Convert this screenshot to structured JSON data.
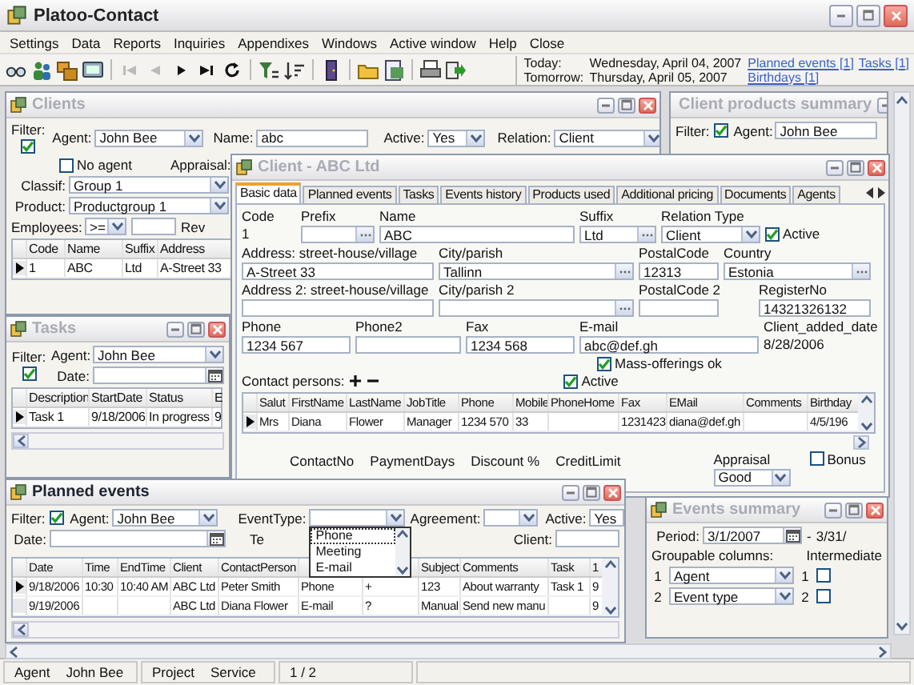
{
  "window": {
    "title": "Platoo-Contact"
  },
  "menu": [
    "Settings",
    "Data",
    "Reports",
    "Inquiries",
    "Appendixes",
    "Windows",
    "Active window",
    "Help",
    "Close"
  ],
  "agenda": {
    "today_label": "Today:",
    "today": "Wednesday, April 04, 2007",
    "tomorrow_label": "Tomorrow:",
    "tomorrow": "Thursday, April 05, 2007",
    "links": [
      "Planned events [1]",
      "Tasks [1]",
      "Birthdays [1]"
    ]
  },
  "clients": {
    "title": "Clients",
    "active": false,
    "filter": {
      "label": "Filter:",
      "checked": true
    },
    "agent": {
      "label": "Agent:",
      "value": "John Bee",
      "kind": "combo"
    },
    "name": {
      "label": "Name:",
      "value": "abc",
      "kind": "text"
    },
    "active_field": {
      "label": "Active:",
      "value": "Yes",
      "kind": "combo"
    },
    "relation": {
      "label": "Relation:",
      "value": "Client",
      "kind": "combo"
    },
    "no_agent": {
      "label": "No agent",
      "checked": false
    },
    "appraisal_label": "Appraisal:",
    "classif": {
      "label": "Classif:",
      "value": "Group 1",
      "kind": "combo"
    },
    "product": {
      "label": "Product:",
      "value": "Productgroup 1",
      "kind": "combo"
    },
    "employees": {
      "label": "Employees:",
      "value": ">=",
      "kind": "combo"
    },
    "employees_value": {
      "kind": "text"
    },
    "rev_label": "Rev",
    "table": {
      "columns": [
        "Code",
        "Name",
        "Suffix",
        "Address"
      ],
      "rows": [
        {
          "selected": true,
          "cells": [
            "1",
            "ABC",
            "Ltd",
            "A-Street 33"
          ]
        }
      ]
    }
  },
  "products_summary": {
    "title": "Client products summary",
    "active": false,
    "filter": {
      "label": "Filter:",
      "checked": true
    },
    "agent": {
      "label": "Agent:",
      "value": "John Bee",
      "kind": "text"
    }
  },
  "tasks": {
    "title": "Tasks",
    "active": false,
    "filter": {
      "label": "Filter:",
      "checked": true
    },
    "agent": {
      "label": "Agent:",
      "value": "John Bee",
      "kind": "combo"
    },
    "date": {
      "label": "Date:",
      "kind": "date"
    },
    "table": {
      "columns": [
        "Description",
        "StartDate",
        "Status",
        "E"
      ],
      "rows": [
        {
          "selected": true,
          "cells": [
            "Task 1",
            "9/18/2006",
            "In progress",
            "9"
          ]
        }
      ]
    }
  },
  "client_card": {
    "title": "Client - ABC Ltd",
    "active": false,
    "tabs": [
      {
        "label": "Basic data",
        "selected": true
      },
      {
        "label": "Planned events",
        "selected": false
      },
      {
        "label": "Tasks",
        "selected": false
      },
      {
        "label": "Events history",
        "selected": false
      },
      {
        "label": "Products used",
        "selected": false
      },
      {
        "label": "Additional pricing",
        "selected": false
      },
      {
        "label": "Documents",
        "selected": false
      },
      {
        "label": "Agents",
        "selected": false
      }
    ],
    "fields": [
      [
        {
          "label": "Code",
          "value": "1",
          "kind": "plain"
        },
        {
          "label": "Prefix",
          "kind": "lookup"
        },
        {
          "label": "Name",
          "value": "ABC",
          "kind": "text"
        },
        {
          "label": "Suffix",
          "value": "Ltd",
          "kind": "lookup"
        },
        {
          "label": "Relation Type",
          "value": "Client",
          "kind": "combo"
        },
        {
          "label": "Active",
          "checked": true,
          "kind": "check"
        }
      ],
      [
        {
          "label": "Address: street-house/village",
          "value": "A-Street 33",
          "kind": "text"
        },
        {
          "label": "City/parish",
          "value": "Tallinn",
          "kind": "lookup"
        },
        {
          "label": "PostalCode",
          "value": "12313",
          "kind": "text"
        },
        {
          "label": "Country",
          "value": "Estonia",
          "kind": "lookup"
        }
      ],
      [
        {
          "label": "Address 2: street-house/village",
          "kind": "text"
        },
        {
          "label": "City/parish 2",
          "kind": "lookup"
        },
        {
          "label": "PostalCode 2",
          "kind": "text"
        },
        {
          "label": "RegisterNo",
          "value": "14321326132",
          "kind": "text"
        }
      ],
      [
        {
          "label": "Phone",
          "value": "1234 567",
          "kind": "text"
        },
        {
          "label": "Phone2",
          "kind": "text"
        },
        {
          "label": "Fax",
          "value": "1234 568",
          "kind": "text"
        },
        {
          "label": "E-mail",
          "value": "abc@def.gh",
          "kind": "text"
        },
        {
          "label": "Client_added_date",
          "value": "8/28/2006",
          "kind": "plain"
        }
      ]
    ],
    "mass_offerings": {
      "label": "Mass-offerings ok",
      "checked": true
    },
    "contacts": {
      "label": "Contact persons:",
      "active": {
        "label": "Active",
        "checked": true
      },
      "table": {
        "columns": [
          "Salut",
          "FirstName",
          "LastName",
          "JobTitle",
          "Phone",
          "Mobile",
          "PhoneHome",
          "Fax",
          "EMail",
          "Comments",
          "Birthday"
        ],
        "rows": [
          {
            "selected": true,
            "cells": [
              "Mrs",
              "Diana",
              "Flower",
              "Manager",
              "1234 570",
              "33",
              null,
              "1231423",
              "diana@def.gh",
              null,
              "4/5/196"
            ]
          }
        ]
      }
    },
    "bottom_labels": [
      "ContactNo",
      "PaymentDays",
      "Discount %",
      "CreditLimit"
    ],
    "appraisal": {
      "label": "Appraisal",
      "value": "Good",
      "kind": "combo"
    },
    "bonus": {
      "label": "Bonus",
      "checked": false
    }
  },
  "planned_events": {
    "title": "Planned events",
    "active": true,
    "filter": {
      "label": "Filter:",
      "checked": true
    },
    "agent": {
      "label": "Agent:",
      "value": "John Bee",
      "kind": "combo"
    },
    "event_type": {
      "label": "EventType:",
      "kind": "combo",
      "options": [
        {
          "label": "Phone",
          "selected": true
        },
        {
          "label": "Meeting",
          "selected": false
        },
        {
          "label": "E-mail",
          "selected": false
        }
      ]
    },
    "agreement": {
      "label": "Agreement:",
      "kind": "combo"
    },
    "active_field": {
      "label": "Active:",
      "value": "Yes",
      "kind": "text"
    },
    "date": {
      "label": "Date:",
      "kind": "date"
    },
    "te_label": "Te",
    "client": {
      "label": "Client:",
      "kind": "text"
    },
    "table": {
      "columns": [
        "Date",
        "Time",
        "EndTime",
        "Client",
        "ContactPerson",
        null,
        null,
        "Subject",
        "Comments",
        "Task",
        "1"
      ],
      "rows": [
        {
          "selected": true,
          "cells": [
            "9/18/2006",
            "10:30",
            "10:40 AM",
            "ABC Ltd",
            "Peter Smith",
            "Phone",
            "+",
            "123",
            "About warranty",
            "Task 1",
            "9"
          ]
        },
        {
          "selected": false,
          "cells": [
            "9/19/2006",
            null,
            null,
            "ABC Ltd",
            "Diana Flower",
            "E-mail",
            "?",
            "Manual",
            "Send new manu",
            null,
            "9"
          ]
        }
      ]
    }
  },
  "events_summary": {
    "title": "Events summary",
    "active": false,
    "period": {
      "label": "Period:",
      "value": "3/1/2007",
      "kind": "date"
    },
    "period_separator": "-",
    "period_to": "3/31/",
    "groupable_label": "Groupable columns:",
    "intermediate_label": "Intermediate",
    "groups": [
      {
        "number": "1",
        "value": "Agent",
        "intermediate_number": "1",
        "checked": false
      },
      {
        "number": "2",
        "value": "Event type",
        "intermediate_number": "2",
        "checked": false
      }
    ]
  },
  "status_bar": [
    {
      "label": "Agent",
      "value": "John Bee"
    },
    {
      "label": "Project",
      "value": "Service"
    },
    {
      "value": "1 / 2"
    }
  ]
}
